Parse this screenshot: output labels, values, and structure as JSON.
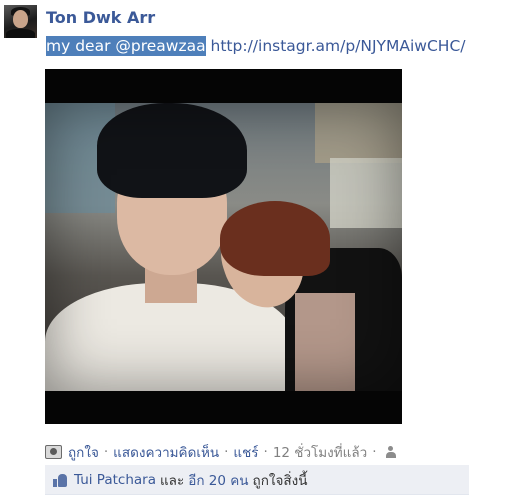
{
  "post": {
    "author": "Ton Dwk Arr",
    "message_selected": "my dear @preawzaa",
    "message_link": "http://instagr.am/p/NJYMAiwCHC/"
  },
  "actions": {
    "like": "ถูกใจ",
    "comment": "แสดงความคิดเห็น",
    "share": "แชร์",
    "timestamp": "12 ชั่วโมงที่แล้ว",
    "separator": "·"
  },
  "likes": {
    "name": "Tui Patchara",
    "and_word": "และ",
    "others": "อีก 20 คน",
    "suffix": "ถูกใจสิ่งนี้"
  },
  "icons": {
    "app": "instagram-app-icon",
    "audience": "friends-audience-icon",
    "like": "thumbs-up-icon"
  },
  "colors": {
    "link": "#3b5998",
    "selection": "#4e7fba",
    "likebox_bg": "#edeff4",
    "meta_text": "#808080"
  }
}
